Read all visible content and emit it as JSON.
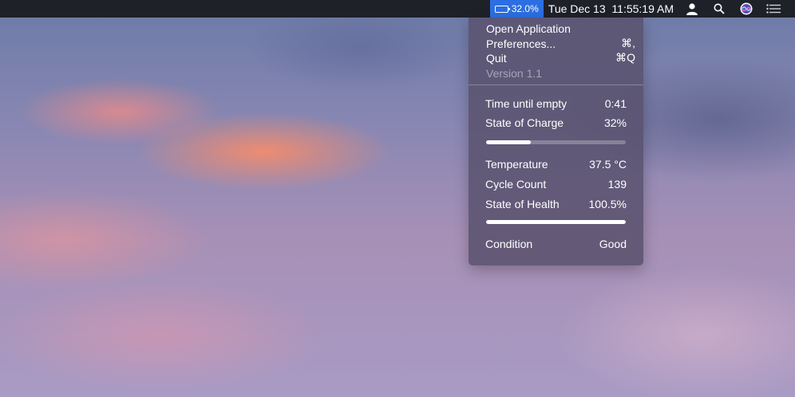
{
  "menubar": {
    "battery_percent": "32.0%",
    "battery_fraction": 0.32,
    "clock": "Tue Dec 13  11:55:19 AM",
    "icons": [
      "user-icon",
      "search-icon",
      "siri-icon",
      "notification-center-icon"
    ],
    "colors": {
      "bar": "#1f2129",
      "battery_highlight": "#2c6fe3"
    }
  },
  "menu": {
    "open_label": "Open Application",
    "preferences_label": "Preferences...",
    "preferences_shortcut": "⌘,",
    "quit_label": "Quit",
    "quit_shortcut": "⌘Q",
    "version_label": "Version 1.1"
  },
  "stats": {
    "time_label": "Time until empty",
    "time_value": "0:41",
    "charge_label": "State of Charge",
    "charge_value": "32%",
    "charge_fraction": 0.32,
    "temp_label": "Temperature",
    "temp_value": "37.5 °C",
    "cycle_label": "Cycle Count",
    "cycle_value": "139",
    "health_label": "State of Health",
    "health_value": "100.5%",
    "health_fraction": 1.0,
    "condition_label": "Condition",
    "condition_value": "Good"
  }
}
